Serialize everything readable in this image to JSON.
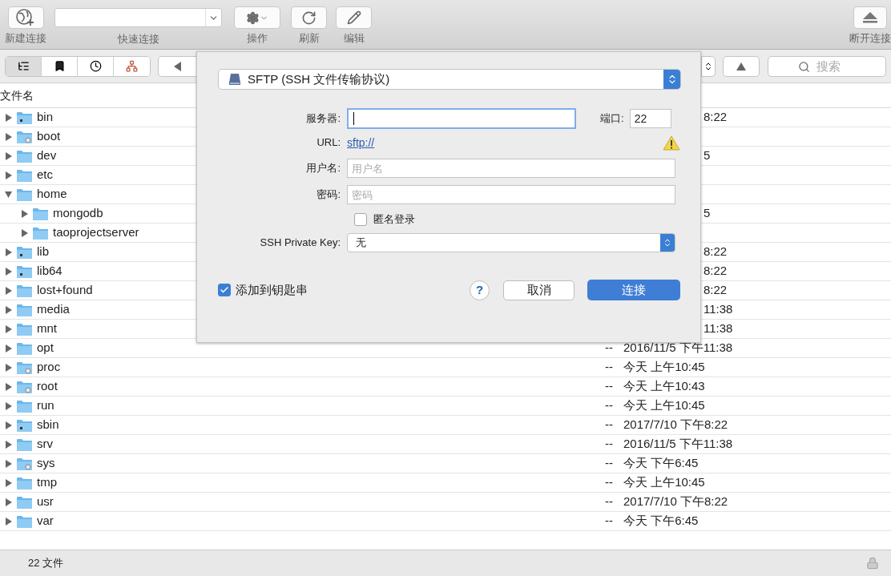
{
  "toolbar": {
    "new_connection": "新建连接",
    "quick_connect": "快速连接",
    "action": "操作",
    "refresh": "刷新",
    "edit": "编辑",
    "disconnect": "断开连接"
  },
  "view_tabs": [
    {
      "selected": true
    },
    {
      "selected": false
    },
    {
      "selected": false
    },
    {
      "selected": false
    }
  ],
  "search": {
    "placeholder": "搜索"
  },
  "table": {
    "columns": [
      "文件名"
    ],
    "rows": [
      {
        "name": "bin",
        "kind": "link",
        "expanded": false,
        "date": "8:22"
      },
      {
        "name": "boot",
        "kind": "mount",
        "expanded": false
      },
      {
        "name": "dev",
        "kind": "folder",
        "expanded": false,
        "date": "5"
      },
      {
        "name": "etc",
        "kind": "folder",
        "expanded": false
      },
      {
        "name": "home",
        "kind": "folder",
        "expanded": true,
        "children": [
          {
            "name": "mongodb",
            "kind": "folder",
            "expanded": false,
            "date": "5"
          },
          {
            "name": "taoprojectserver",
            "kind": "folder",
            "expanded": false
          }
        ]
      },
      {
        "name": "lib",
        "kind": "link",
        "expanded": false,
        "date": "8:22"
      },
      {
        "name": "lib64",
        "kind": "link",
        "expanded": false,
        "date": "8:22"
      },
      {
        "name": "lost+found",
        "kind": "folder",
        "expanded": false,
        "date": "8:22"
      },
      {
        "name": "media",
        "kind": "folder",
        "expanded": false,
        "date": "11:38"
      },
      {
        "name": "mnt",
        "kind": "folder",
        "expanded": false,
        "date": "11:38"
      },
      {
        "name": "opt",
        "kind": "folder",
        "expanded": false,
        "size": "--",
        "date": "2016/11/5 下午11:38"
      },
      {
        "name": "proc",
        "kind": "mount",
        "expanded": false,
        "size": "--",
        "date": "今天 上午10:45"
      },
      {
        "name": "root",
        "kind": "mount",
        "expanded": false,
        "size": "--",
        "date": "今天 上午10:43"
      },
      {
        "name": "run",
        "kind": "folder",
        "expanded": false,
        "size": "--",
        "date": "今天 上午10:45"
      },
      {
        "name": "sbin",
        "kind": "link",
        "expanded": false,
        "size": "--",
        "date": "2017/7/10 下午8:22"
      },
      {
        "name": "srv",
        "kind": "folder",
        "expanded": false,
        "size": "--",
        "date": "2016/11/5 下午11:38"
      },
      {
        "name": "sys",
        "kind": "mount",
        "expanded": false,
        "size": "--",
        "date": "今天 下午6:45"
      },
      {
        "name": "tmp",
        "kind": "folder",
        "expanded": false,
        "size": "--",
        "date": "今天 上午10:45"
      },
      {
        "name": "usr",
        "kind": "folder",
        "expanded": false,
        "size": "--",
        "date": "2017/7/10 下午8:22"
      },
      {
        "name": "var",
        "kind": "folder",
        "expanded": false,
        "size": "--",
        "date": "今天 下午6:45"
      }
    ]
  },
  "status_bar": {
    "text": "22 文件"
  },
  "dialog": {
    "protocol": "SFTP (SSH 文件传输协议)",
    "server": {
      "label": "服务器:",
      "focused": true
    },
    "port": {
      "label": "端口:",
      "value": "22"
    },
    "url": {
      "label": "URL:",
      "link": "sftp://"
    },
    "username": {
      "label": "用户名:",
      "placeholder": "用户名"
    },
    "password": {
      "label": "密码:",
      "placeholder": "密码"
    },
    "anonymous": {
      "label": "匿名登录",
      "checked": false
    },
    "private_key": {
      "label": "SSH Private Key:",
      "value": "无"
    },
    "keychain": {
      "label": "添加到钥匙串",
      "checked": true
    },
    "help": "?",
    "cancel": "取消",
    "connect": "连接"
  }
}
